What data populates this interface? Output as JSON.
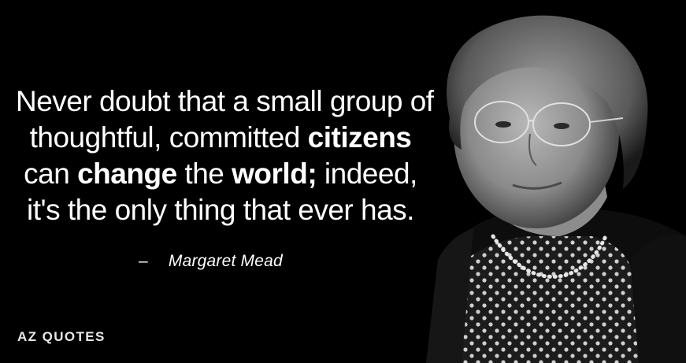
{
  "quote": {
    "line1": "Never doubt that a small group of",
    "line2_pre": "thoughtful, committed ",
    "line2_bold": "citizens",
    "line3_pre": "can ",
    "line3_bold1": "change",
    "line3_mid": " the ",
    "line3_bold2": "world;",
    "line3_post": " indeed,",
    "line4": "it's the only thing that ever has."
  },
  "attribution": {
    "dash": "–",
    "author": "Margaret Mead"
  },
  "logo": {
    "text": "AZ QUOTES"
  },
  "colors": {
    "background": "#000000",
    "text": "#ffffff"
  }
}
